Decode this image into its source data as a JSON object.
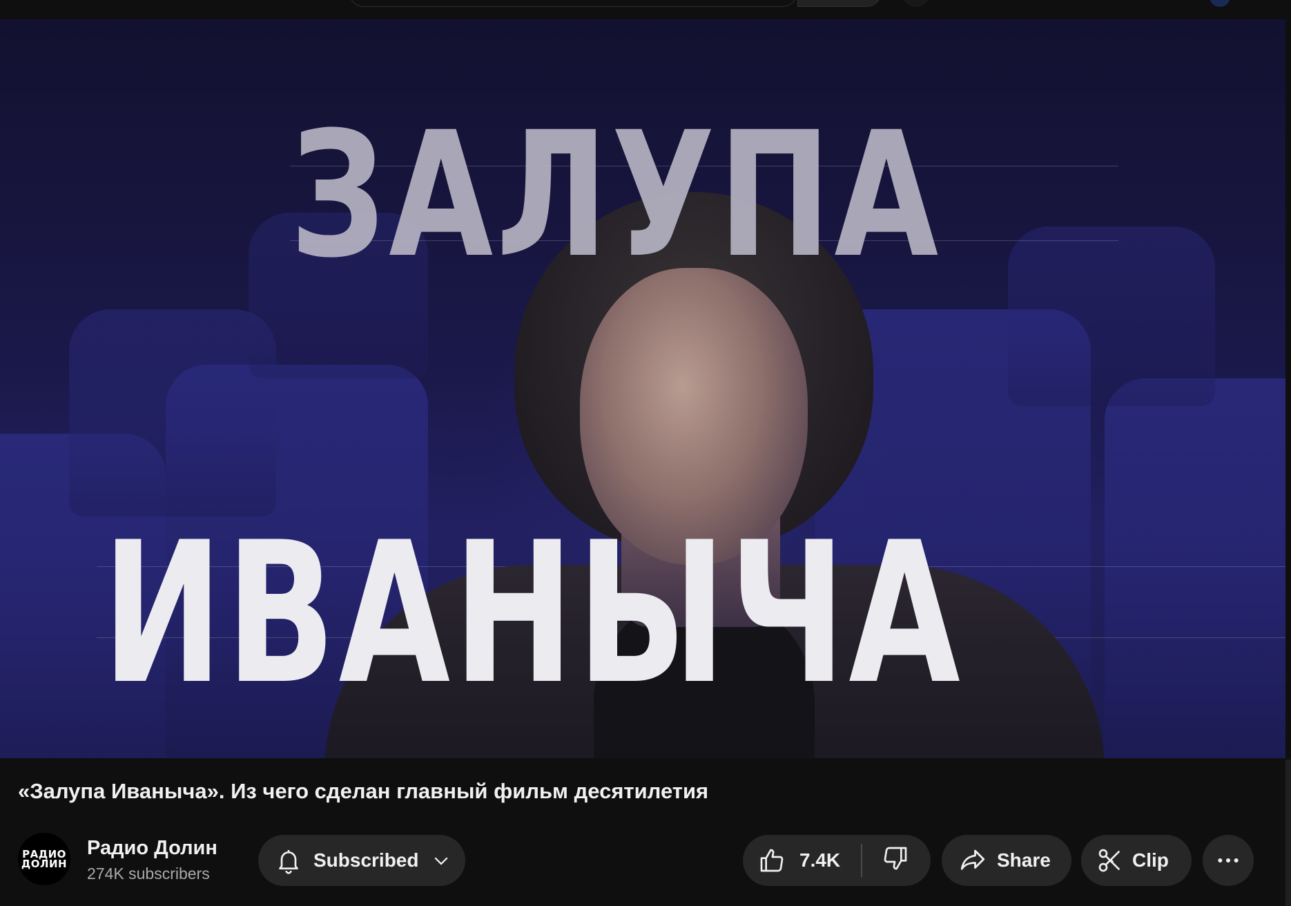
{
  "thumbnail": {
    "line1": "ЗАЛУПА",
    "line2": "ИВАНЫЧА"
  },
  "video": {
    "title": "«Залупа Иваныча». Из чего сделан главный фильм десятилетия"
  },
  "channel": {
    "avatar_line1": "РАДИО",
    "avatar_line2": "ДОЛИН",
    "name": "Радио Долин",
    "subscribers": "274K subscribers"
  },
  "actions": {
    "subscribe_label": "Subscribed",
    "like_count": "7.4K",
    "share_label": "Share",
    "clip_label": "Clip"
  },
  "icons": {
    "bell": "bell-icon",
    "chevron": "chevron-down-icon",
    "like": "thumbs-up-icon",
    "dislike": "thumbs-down-icon",
    "share": "share-arrow-icon",
    "clip": "scissors-icon",
    "more": "more-horizontal-icon"
  },
  "colors": {
    "background": "#0f0f0f",
    "pill": "#272727",
    "text_primary": "#f1f1f1",
    "text_secondary": "#aaaaaa"
  }
}
